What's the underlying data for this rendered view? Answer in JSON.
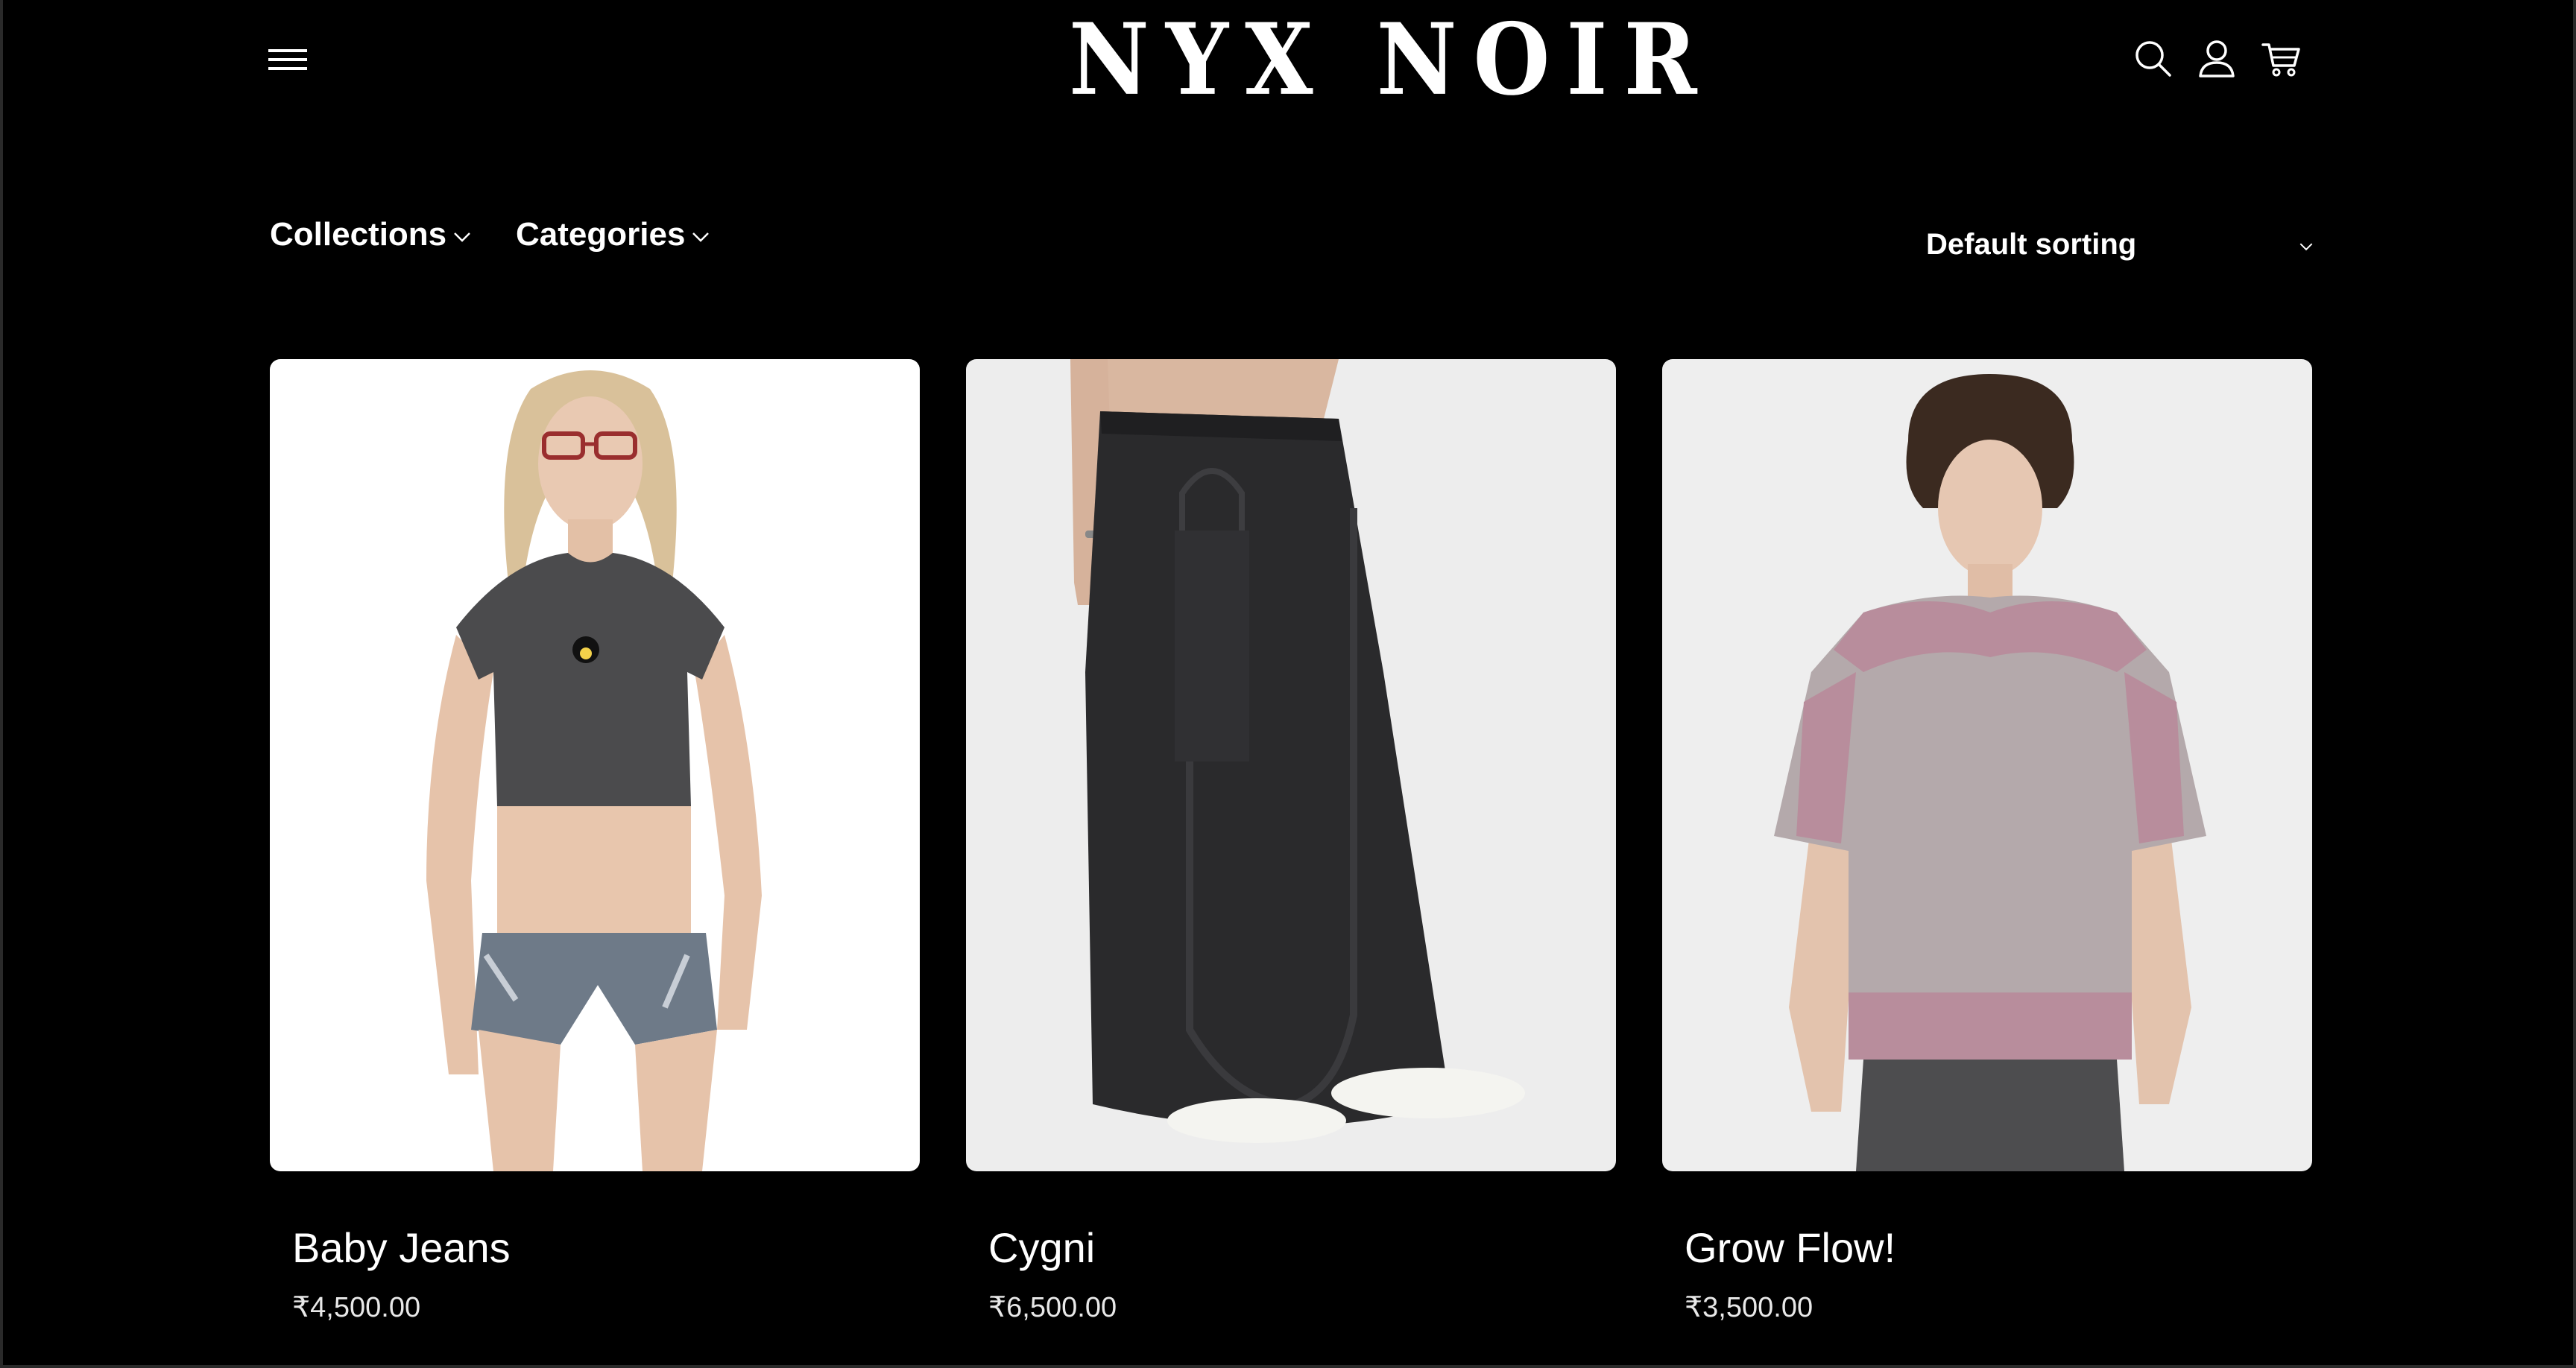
{
  "header": {
    "brand_name": "NYX NOIR",
    "icons": {
      "menu": "hamburger-menu-icon",
      "search": "search-icon",
      "account": "user-icon",
      "cart": "cart-icon"
    }
  },
  "toolbar": {
    "filters": [
      {
        "label": "Collections"
      },
      {
        "label": "Categories"
      }
    ],
    "sorting": {
      "selected": "Default sorting"
    }
  },
  "products": [
    {
      "title": "Baby Jeans",
      "price": "₹4,500.00",
      "background": "#ffffff"
    },
    {
      "title": "Cygni",
      "price": "₹6,500.00",
      "background": "#ededed"
    },
    {
      "title": "Grow Flow!",
      "price": "₹3,500.00",
      "background": "#eeeeee"
    }
  ],
  "colors": {
    "page_background": "#000000",
    "text": "#ffffff"
  }
}
